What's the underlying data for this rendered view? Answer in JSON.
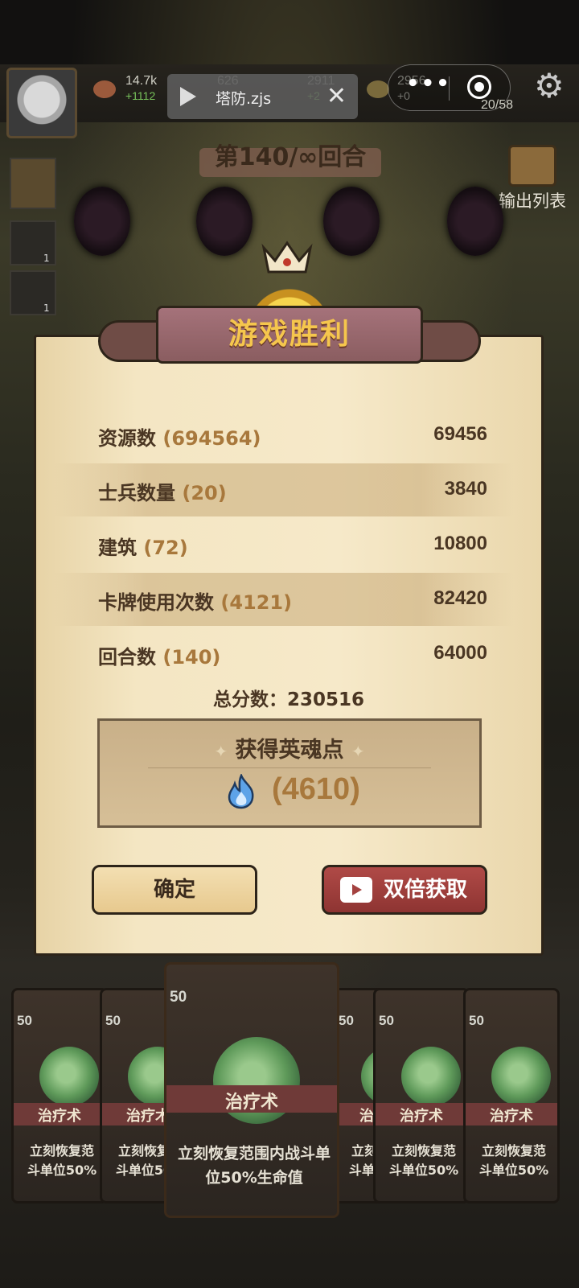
{
  "topbar": {
    "res1": {
      "value": "14.7k",
      "delta": "+1112"
    },
    "res2": {
      "value": "626",
      "delta": ""
    },
    "res3": {
      "value": "2911",
      "delta": "+2"
    },
    "res4": {
      "value": "2956",
      "delta": "+0"
    },
    "unit_count": "20/58"
  },
  "miniapp": {
    "title": "塔防.zjs",
    "close": "✕",
    "dots": "•••"
  },
  "round_banner": {
    "text": "第140/∞回合"
  },
  "output_list": {
    "label": "输出列表"
  },
  "side_slots": [
    {
      "num": "1"
    },
    {
      "num": "1"
    }
  ],
  "dialog": {
    "title": "游戏胜利",
    "rows": [
      {
        "label": "资源数",
        "count": "(694564)",
        "value": "69456"
      },
      {
        "label": "士兵数量",
        "count": "(20)",
        "value": "3840"
      },
      {
        "label": "建筑",
        "count": "(72)",
        "value": "10800"
      },
      {
        "label": "卡牌使用次数",
        "count": "(4121)",
        "value": "82420"
      },
      {
        "label": "回合数",
        "count": "(140)",
        "value": "64000"
      }
    ],
    "total": "总分数：230516",
    "reward": {
      "heading": "获得英魂点",
      "points": "(4610)",
      "star": "✦"
    },
    "confirm_label": "确定",
    "double_label": "双倍获取"
  },
  "cards": {
    "cost": "50",
    "name": "治疗术",
    "name_short": "治疗术",
    "desc": "立刻恢复范围内战斗单位50%生命值",
    "desc_short1": "立刻恢复范",
    "desc_short2": "斗单位50%"
  },
  "colors": {
    "accent_gold": "#f5c64d",
    "count_brown": "#a8783c",
    "button_red": "#a44240"
  }
}
